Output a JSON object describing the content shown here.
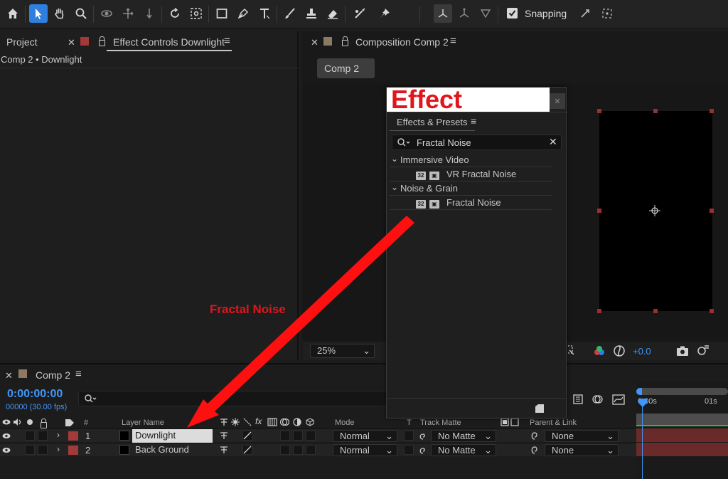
{
  "toolbar": {
    "snapping_label": "Snapping"
  },
  "left_panel": {
    "project_tab": "Project",
    "effect_controls_tab": "Effect Controls Downlight",
    "breadcrumb": "Comp 2 • Downlight"
  },
  "comp_panel": {
    "tab": "Composition Comp 2",
    "comp_button": "Comp 2",
    "zoom": "25%",
    "exposure": "+0.0"
  },
  "effects_panel": {
    "banner": "Effect",
    "title": "Effects & Presets",
    "search_value": "Fractal Noise",
    "groups": [
      {
        "name": "Immersive Video",
        "items": [
          {
            "badge": "32",
            "label": "VR Fractal Noise"
          }
        ]
      },
      {
        "name": "Noise & Grain",
        "items": [
          {
            "badge": "32",
            "label": "Fractal Noise"
          }
        ]
      }
    ]
  },
  "annotation": {
    "label": "Fractal Noise"
  },
  "timeline": {
    "tab": "Comp 2",
    "timecode": "0:00:00:00",
    "fps": "00000 (30.00 fps)",
    "columns": {
      "hash": "#",
      "layer_name": "Layer Name",
      "mode": "Mode",
      "t": "T",
      "track_matte": "Track Matte",
      "parent": "Parent & Link"
    },
    "ruler": {
      "start": "0:00s",
      "mark": "01s"
    },
    "layers": [
      {
        "index": "1",
        "name": "Downlight",
        "mode": "Normal",
        "matte": "No Matte",
        "parent": "None"
      },
      {
        "index": "2",
        "name": "Back Ground",
        "mode": "Normal",
        "matte": "No Matte",
        "parent": "None"
      }
    ]
  },
  "colors": {
    "accent_blue": "#2f7fe0",
    "timecode_blue": "#3f97f7",
    "annotation_red": "#e0161c",
    "layer_label_red": "#a33a3a"
  }
}
